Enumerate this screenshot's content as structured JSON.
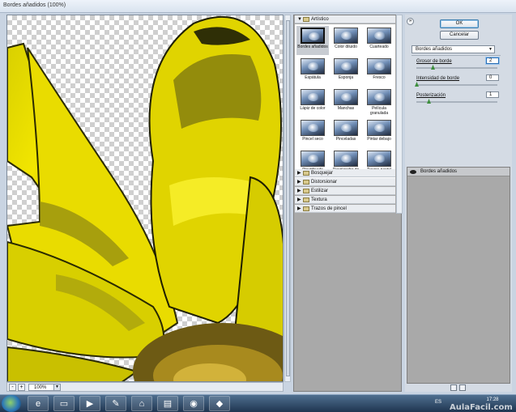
{
  "window": {
    "title": "Bordes añadidos (100%)"
  },
  "preview": {
    "zoom": "100%",
    "zoom_out_symbol": "-",
    "zoom_in_symbol": "+"
  },
  "gallery": {
    "open_category": "Artístico",
    "thumbnails": [
      {
        "label": "Bordes añadidos",
        "selected": true
      },
      {
        "label": "Color diluido"
      },
      {
        "label": "Cuarteado"
      },
      {
        "label": "Espátula"
      },
      {
        "label": "Esponja"
      },
      {
        "label": "Fresco"
      },
      {
        "label": "Lápiz de color"
      },
      {
        "label": "Manchas"
      },
      {
        "label": "Película granulada"
      },
      {
        "label": "Pincel seco"
      },
      {
        "label": "Pinceladas"
      },
      {
        "label": "Pintar debajo"
      },
      {
        "label": "Plastificado"
      },
      {
        "label": "Resplandor de neón"
      },
      {
        "label": "Trazos pastel"
      }
    ],
    "categories": [
      "Bosquejar",
      "Distorsionar",
      "Estilizar",
      "Textura",
      "Trazos de pincel"
    ]
  },
  "dialog": {
    "ok_label": "OK",
    "cancel_label": "Cancelar",
    "filter_selected": "Bordes añadidos",
    "params": [
      {
        "label": "Grosor de borde",
        "value": "2",
        "level": 0.2
      },
      {
        "label": "Intensidad de borde",
        "value": "0",
        "level": 0.0
      },
      {
        "label": "Posterización",
        "value": "1",
        "level": 0.15
      }
    ],
    "layer_name": "Bordes añadidos"
  },
  "taskbar": {
    "language": "ES",
    "time": "17:28",
    "watermark": "AulaFacil.com",
    "items": [
      {
        "icon": "internet-explorer-icon",
        "glyph": "e"
      },
      {
        "icon": "folder-icon",
        "glyph": "▭"
      },
      {
        "icon": "media-player-icon",
        "glyph": "▶"
      },
      {
        "icon": "paint-icon",
        "glyph": "✎"
      },
      {
        "icon": "network-icon",
        "glyph": "⌂"
      },
      {
        "icon": "printer-icon",
        "glyph": "▤"
      },
      {
        "icon": "chrome-icon",
        "glyph": "◉"
      },
      {
        "icon": "app-icon",
        "glyph": "◆"
      }
    ]
  },
  "colors": {
    "petal_yellow": "#e6d400",
    "petal_dark": "#6b6a10",
    "center_brown": "#6d5a14"
  }
}
